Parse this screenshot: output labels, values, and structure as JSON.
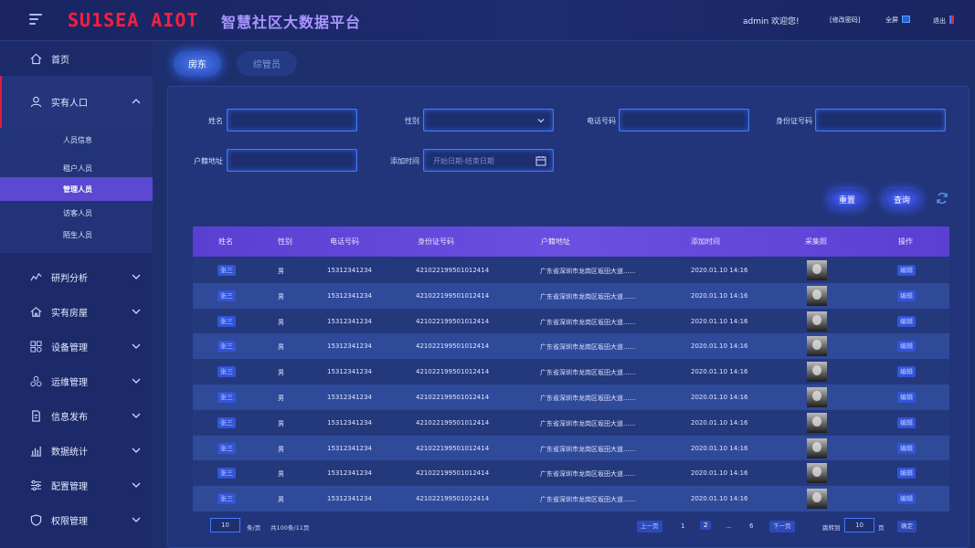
{
  "header": {
    "logo": "SU1SEA AIOT",
    "title": "智慧社区大数据平台",
    "user_greeting": "admin  欢迎您!",
    "change_password": "[修改密码]",
    "fullscreen": "全屏",
    "logout": "退出"
  },
  "sidebar": {
    "home": "首页",
    "people": "实有人口",
    "sub_items": [
      "人员信息",
      "租户人员",
      "管理人员",
      "访客人员",
      "陌生人员"
    ],
    "active_sub": "管理人员",
    "sections": [
      "研判分析",
      "实有房屋",
      "设备管理",
      "运维管理",
      "信息发布",
      "数据统计",
      "配置管理",
      "权限管理"
    ]
  },
  "tabs": {
    "active": "房东",
    "inactive": "综管员"
  },
  "filters": {
    "name_label": "姓名",
    "gender_label": "性别",
    "phone_label": "电话号码",
    "id_label": "身份证号码",
    "address_label": "户籍地址",
    "date_label": "添加时间",
    "date_placeholder": "开始日期-结束日期"
  },
  "buttons": {
    "reset": "重置",
    "query": "查询"
  },
  "table": {
    "headers": [
      "姓名",
      "性别",
      "电话号码",
      "身份证号码",
      "户籍地址",
      "添加时间",
      "采集照",
      "操作"
    ],
    "rows": [
      {
        "name": "张三",
        "gender": "男",
        "phone": "15312341234",
        "id": "421022199501012414",
        "address": "广东省深圳市龙岗区坂田大道......",
        "time": "2020.01.10 14:16",
        "action": "编辑"
      },
      {
        "name": "张三",
        "gender": "男",
        "phone": "15312341234",
        "id": "421022199501012414",
        "address": "广东省深圳市龙岗区坂田大道......",
        "time": "2020.01.10 14:16",
        "action": "编辑"
      },
      {
        "name": "张三",
        "gender": "男",
        "phone": "15312341234",
        "id": "421022199501012414",
        "address": "广东省深圳市龙岗区坂田大道......",
        "time": "2020.01.10 14:16",
        "action": "编辑"
      },
      {
        "name": "张三",
        "gender": "男",
        "phone": "15312341234",
        "id": "421022199501012414",
        "address": "广东省深圳市龙岗区坂田大道......",
        "time": "2020.01.10 14:16",
        "action": "编辑"
      },
      {
        "name": "张三",
        "gender": "男",
        "phone": "15312341234",
        "id": "421022199501012414",
        "address": "广东省深圳市龙岗区坂田大道......",
        "time": "2020.01.10 14:16",
        "action": "编辑"
      },
      {
        "name": "张三",
        "gender": "男",
        "phone": "15312341234",
        "id": "421022199501012414",
        "address": "广东省深圳市龙岗区坂田大道......",
        "time": "2020.01.10 14:16",
        "action": "编辑"
      },
      {
        "name": "张三",
        "gender": "男",
        "phone": "15312341234",
        "id": "421022199501012414",
        "address": "广东省深圳市龙岗区坂田大道......",
        "time": "2020.01.10 14:16",
        "action": "编辑"
      },
      {
        "name": "张三",
        "gender": "男",
        "phone": "15312341234",
        "id": "421022199501012414",
        "address": "广东省深圳市龙岗区坂田大道......",
        "time": "2020.01.10 14:16",
        "action": "编辑"
      },
      {
        "name": "张三",
        "gender": "男",
        "phone": "15312341234",
        "id": "421022199501012414",
        "address": "广东省深圳市龙岗区坂田大道......",
        "time": "2020.01.10 14:16",
        "action": "编辑"
      },
      {
        "name": "张三",
        "gender": "男",
        "phone": "15312341234",
        "id": "421022199501012414",
        "address": "广东省深圳市龙岗区坂田大道......",
        "time": "2020.01.10 14:16",
        "action": "编辑"
      }
    ]
  },
  "pagination": {
    "page_size": "10",
    "per_page_label": "条/页",
    "total": "共100条/11页",
    "prev": "上一页",
    "pages": [
      "1",
      "2",
      "...",
      "6"
    ],
    "current": "2",
    "next": "下一页",
    "jump_label": "跳转到",
    "jump_value": "10",
    "page_unit": "页",
    "confirm": "确定"
  }
}
